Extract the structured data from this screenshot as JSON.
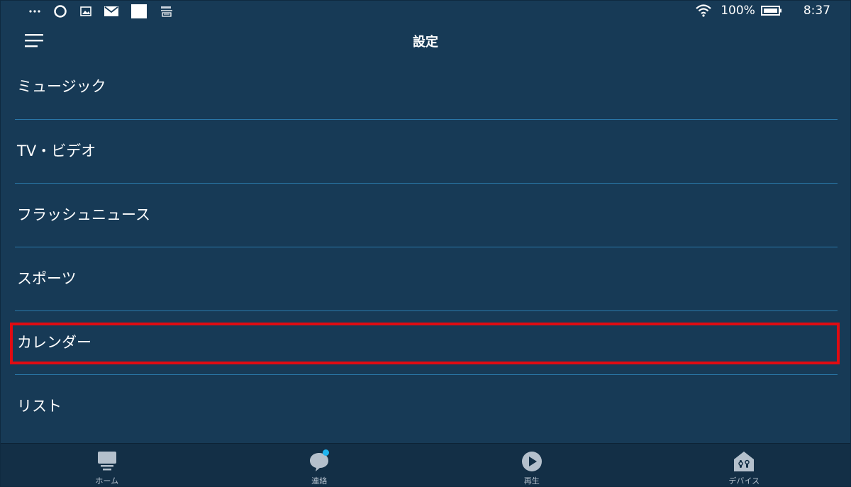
{
  "status_bar": {
    "battery": "100%",
    "time": "8:37"
  },
  "header": {
    "title": "設定"
  },
  "settings": {
    "items": [
      {
        "label": "ミュージック"
      },
      {
        "label": "TV・ビデオ"
      },
      {
        "label": "フラッシュニュース"
      },
      {
        "label": "スポーツ"
      },
      {
        "label": "カレンダー"
      },
      {
        "label": "リスト"
      }
    ]
  },
  "bottom_nav": {
    "items": [
      {
        "label": "ホーム",
        "icon": "home-icon"
      },
      {
        "label": "連絡",
        "icon": "chat-bubble-icon"
      },
      {
        "label": "再生",
        "icon": "play-icon"
      },
      {
        "label": "デバイス",
        "icon": "home-devices-icon"
      }
    ]
  },
  "colors": {
    "background": "#173a56",
    "divider": "#2a77a8",
    "highlight": "#e00b12",
    "notification": "#1fb5f0"
  }
}
